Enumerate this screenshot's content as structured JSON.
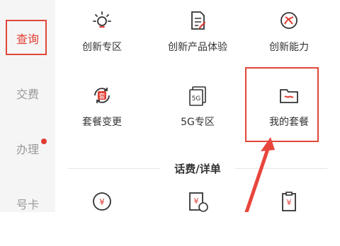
{
  "sidebar": {
    "items": [
      {
        "label": "查询",
        "active": true
      },
      {
        "label": "交费",
        "active": false
      },
      {
        "label": "办理",
        "active": false,
        "badge": true
      },
      {
        "label": "号卡",
        "active": false
      }
    ]
  },
  "grid": {
    "row1": [
      {
        "label": "创新专区",
        "icon": "lightbulb-icon"
      },
      {
        "label": "创新产品体验",
        "icon": "document-edit-icon"
      },
      {
        "label": "创新能力",
        "icon": "innovation-badge-icon"
      }
    ],
    "row2": [
      {
        "label": "套餐变更",
        "icon": "package-change-icon",
        "icon_text": "套"
      },
      {
        "label": "5G专区",
        "icon": "5g-icon",
        "icon_text": "5G"
      },
      {
        "label": "我的套餐",
        "icon": "folder-icon"
      }
    ],
    "row3": [
      {
        "icon": "yuan-coin-icon",
        "icon_text": "¥"
      },
      {
        "icon": "bill-clock-icon",
        "icon_text": "¥"
      },
      {
        "icon": "clipboard-bill-icon",
        "icon_text": "¥"
      }
    ]
  },
  "section": {
    "title": "话费/详单"
  },
  "colors": {
    "accent": "#e03c31",
    "highlight": "#e0473a",
    "text": "#333333",
    "muted": "#999999"
  }
}
